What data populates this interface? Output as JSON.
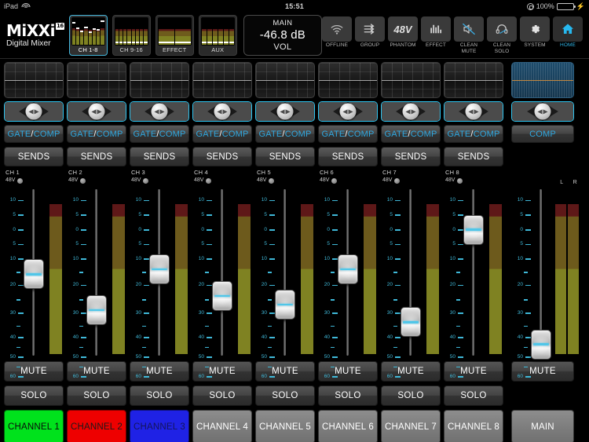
{
  "statusbar": {
    "device": "iPad",
    "wifi_icon": "wifi-icon",
    "time": "15:51",
    "lock_icon": "rotation-lock-icon",
    "battery_percent": "100%",
    "charging_icon": "lightning-bolt-icon"
  },
  "header": {
    "logo_text": "MiXXi",
    "logo_badge": "16",
    "logo_subtitle": "Digital Mixer",
    "thumbnails": [
      {
        "label": "CH 1-8",
        "selected": true,
        "bars": [
          62,
          58,
          55,
          60,
          57,
          59,
          56,
          61
        ],
        "caps": [
          80,
          58,
          47,
          62,
          44,
          56,
          52,
          86
        ]
      },
      {
        "label": "CH 9-16",
        "selected": false,
        "bars": [
          58,
          58,
          58,
          58,
          58,
          58,
          58,
          58
        ],
        "caps": [
          6,
          6,
          6,
          6,
          6,
          6,
          6,
          6
        ]
      },
      {
        "label": "EFFECT",
        "selected": false,
        "bars": [
          60,
          60
        ],
        "caps": [
          6,
          6
        ]
      },
      {
        "label": "AUX",
        "selected": false,
        "bars": [
          58,
          58,
          58,
          58,
          58,
          58
        ],
        "caps": [
          6,
          6,
          6,
          6,
          6,
          6
        ]
      }
    ],
    "vol_display": {
      "top_label": "MAIN",
      "value": "-46.8 dB",
      "bottom_label": "VOL"
    },
    "toolbar": [
      {
        "label": "OFFLINE",
        "icon": "wifi-icon",
        "active": false
      },
      {
        "label": "GROUP",
        "icon": "group-arrows-icon",
        "active": false
      },
      {
        "label": "PHANTOM",
        "icon": "48v-icon",
        "icon_text": "48V",
        "active": false
      },
      {
        "label": "EFFECT",
        "icon": "equalizer-bars-icon",
        "active": false
      },
      {
        "label": "CLEAN MUTE",
        "label_line1": "CLEAN",
        "label_line2": "MUTE",
        "icon": "muted-speaker-icon",
        "active": false
      },
      {
        "label": "CLEAN SOLO",
        "label_line1": "CLEAN",
        "label_line2": "SOLO",
        "icon": "headphones-icon",
        "active": false
      },
      {
        "label": "SYSTEM",
        "icon": "gear-icon",
        "active": false
      },
      {
        "label": "HOME",
        "icon": "home-icon",
        "active": true
      }
    ]
  },
  "channels": [
    {
      "name": "CH 1",
      "phantom_label": "48V",
      "eq_button": "GATE/COMP",
      "sends_button": "SENDS",
      "mute_button": "MUTE",
      "solo_button": "SOLO",
      "button_label": "CHANNEL 1",
      "color": "green",
      "fader_db": -17,
      "meter_level": 92
    },
    {
      "name": "CH 2",
      "phantom_label": "48V",
      "eq_button": "GATE/COMP",
      "sends_button": "SENDS",
      "mute_button": "MUTE",
      "solo_button": "SOLO",
      "button_label": "CHANNEL 2",
      "color": "red",
      "fader_db": -30,
      "meter_level": 92
    },
    {
      "name": "CH 3",
      "phantom_label": "48V",
      "eq_button": "GATE/COMP",
      "sends_button": "SENDS",
      "mute_button": "MUTE",
      "solo_button": "SOLO",
      "button_label": "CHANNEL 3",
      "color": "blue",
      "fader_db": -15,
      "meter_level": 92
    },
    {
      "name": "CH 4",
      "phantom_label": "48V",
      "eq_button": "GATE/COMP",
      "sends_button": "SENDS",
      "mute_button": "MUTE",
      "solo_button": "SOLO",
      "button_label": "CHANNEL 4",
      "color": "gray",
      "fader_db": -25,
      "meter_level": 92
    },
    {
      "name": "CH 5",
      "phantom_label": "48V",
      "eq_button": "GATE/COMP",
      "sends_button": "SENDS",
      "mute_button": "MUTE",
      "solo_button": "SOLO",
      "button_label": "CHANNEL 5",
      "color": "gray",
      "fader_db": -28,
      "meter_level": 92
    },
    {
      "name": "CH 6",
      "phantom_label": "48V",
      "eq_button": "GATE/COMP",
      "sends_button": "SENDS",
      "mute_button": "MUTE",
      "solo_button": "SOLO",
      "button_label": "CHANNEL 6",
      "color": "gray",
      "fader_db": -15,
      "meter_level": 92
    },
    {
      "name": "CH 7",
      "phantom_label": "48V",
      "eq_button": "GATE/COMP",
      "sends_button": "SENDS",
      "mute_button": "MUTE",
      "solo_button": "SOLO",
      "button_label": "CHANNEL 7",
      "color": "gray",
      "fader_db": -35,
      "meter_level": 92
    },
    {
      "name": "CH 8",
      "phantom_label": "48V",
      "eq_button": "GATE/COMP",
      "sends_button": "SENDS",
      "mute_button": "MUTE",
      "solo_button": "SOLO",
      "button_label": "CHANNEL 8",
      "color": "gray",
      "fader_db": -1,
      "meter_level": 92
    }
  ],
  "main_strip": {
    "comp_button": "COMP",
    "mute_button": "MUTE",
    "button_label": "MAIN",
    "meter_left_label": "L",
    "meter_right_label": "R",
    "fader_db": -45,
    "meter_level": 92
  },
  "fader_scale": [
    {
      "label": "10",
      "pos": 4
    },
    {
      "label": "5",
      "pos": 13
    },
    {
      "label": "0",
      "pos": 22
    },
    {
      "label": "5",
      "pos": 31
    },
    {
      "label": "10",
      "pos": 40
    },
    {
      "label": "",
      "pos": 48
    },
    {
      "label": "20",
      "pos": 56
    },
    {
      "label": "",
      "pos": 65
    },
    {
      "label": "30",
      "pos": 73
    },
    {
      "label": "",
      "pos": 81
    },
    {
      "label": "40",
      "pos": 88
    },
    {
      "label": "",
      "pos": 94
    },
    {
      "label": "50",
      "pos": 100
    },
    {
      "label": "",
      "pos": 106
    },
    {
      "label": "60",
      "pos": 112
    }
  ],
  "colors": {
    "accent_cyan": "#2fb6e8",
    "channel_green": "#00e21c",
    "channel_red": "#ee0000",
    "channel_blue": "#1f22e5",
    "meter_green": "#7f8222",
    "meter_amber": "#6d5a1c",
    "meter_red": "#5e1818",
    "battery_green": "#3ad12a"
  }
}
